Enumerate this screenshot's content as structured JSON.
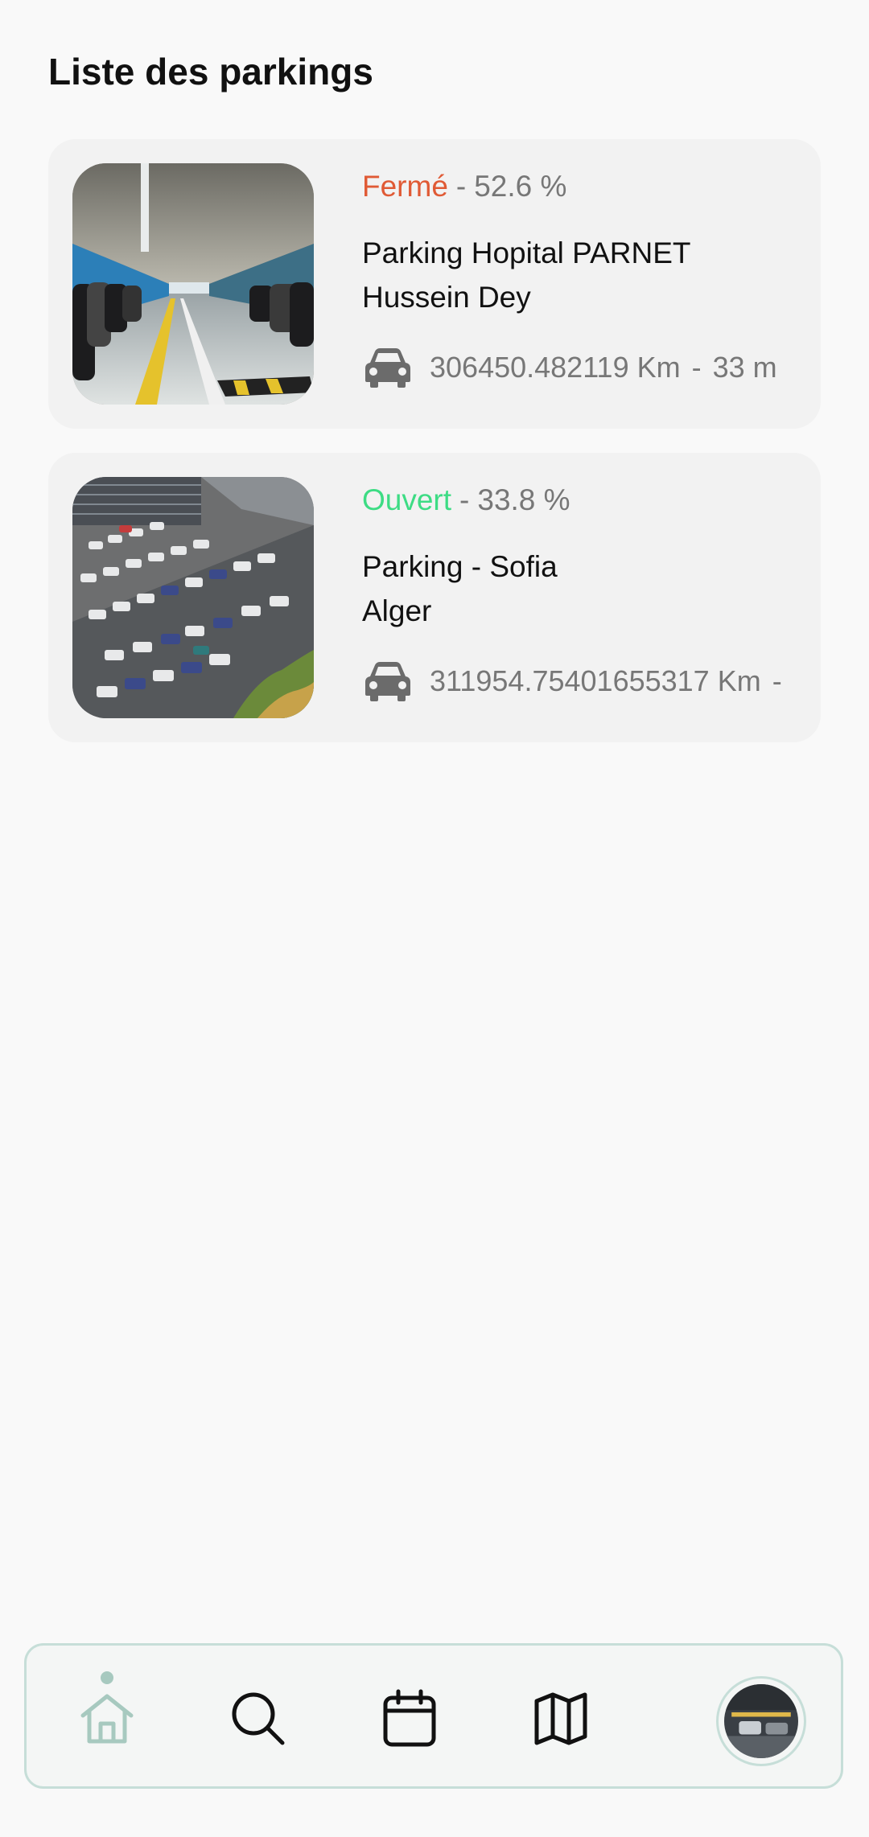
{
  "page": {
    "title": "Liste des parkings"
  },
  "colors": {
    "closed": "#e05a35",
    "open": "#3ddc84",
    "muted": "#777777",
    "nav_active": "#a7c9bf"
  },
  "parkings": [
    {
      "status": "Fermé",
      "occupancy": "52.6 %",
      "name_line1": "Parking Hopital PARNET",
      "name_line2": "Hussein Dey",
      "distance": "306450.482119 Km",
      "duration": "33 m",
      "image": "indoor-parking-photo"
    },
    {
      "status": "Ouvert",
      "occupancy": "33.8 %",
      "name_line1": "Parking - Sofia",
      "name_line2": "Alger",
      "distance": "311954.75401655317 Km",
      "duration": "",
      "image": "outdoor-parking-photo"
    }
  ],
  "separator": "-",
  "nav": {
    "items": [
      {
        "icon": "home-icon",
        "active": true
      },
      {
        "icon": "search-icon",
        "active": false
      },
      {
        "icon": "calendar-icon",
        "active": false
      },
      {
        "icon": "map-icon",
        "active": false
      }
    ],
    "avatar": "profile-avatar"
  }
}
